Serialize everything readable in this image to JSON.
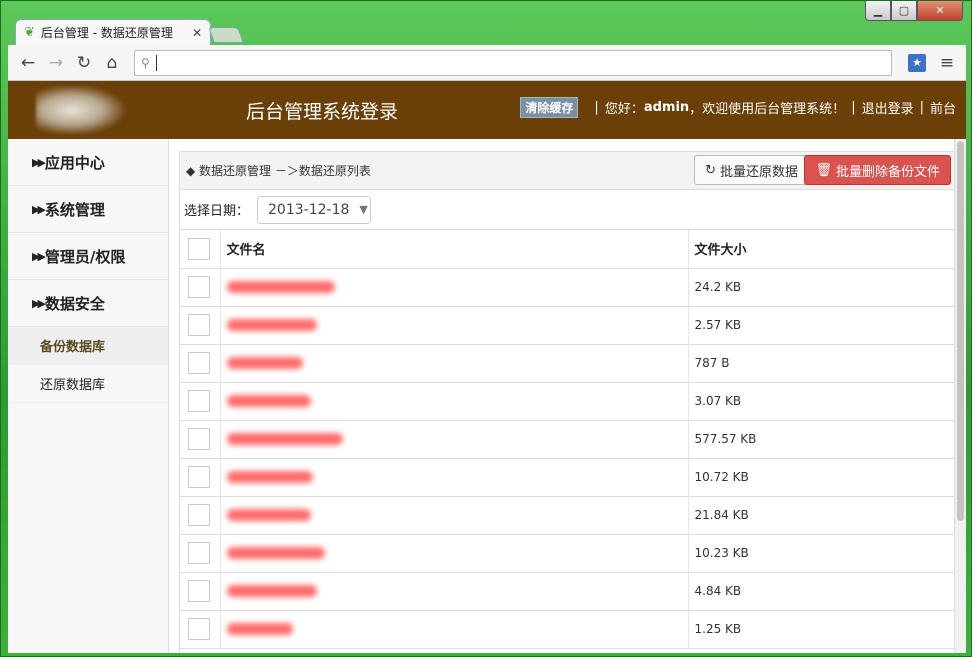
{
  "browser": {
    "tab_title": "后台管理 - 数据还原管理",
    "url": ""
  },
  "header": {
    "site_title": "后台管理系统登录",
    "clear_cache": "清除缓存",
    "greeting": "您好：",
    "user": "admin",
    "welcome": "，欢迎使用后台管理系统！",
    "logout": "退出登录",
    "frontend": "前台"
  },
  "sidebar": {
    "groups": [
      {
        "label": "应用中心"
      },
      {
        "label": "系统管理"
      },
      {
        "label": "管理员/权限"
      },
      {
        "label": "数据安全"
      }
    ],
    "subitems": [
      {
        "label": "备份数据库"
      },
      {
        "label": "还原数据库"
      }
    ]
  },
  "main": {
    "breadcrumb": "◆ 数据还原管理 －＞数据还原列表",
    "restore_button": "批量还原数据",
    "delete_button": "批量删除备份文件",
    "filter_label": "选择日期：",
    "date_value": "2013-12-18",
    "columns": {
      "name": "文件名",
      "size": "文件大小"
    },
    "rows": [
      {
        "size": "24.2 KB",
        "redact_w": 108
      },
      {
        "size": "2.57 KB",
        "redact_w": 90
      },
      {
        "size": "787 B",
        "redact_w": 76
      },
      {
        "size": "3.07 KB",
        "redact_w": 84
      },
      {
        "size": "577.57 KB",
        "redact_w": 116
      },
      {
        "size": "10.72 KB",
        "redact_w": 86
      },
      {
        "size": "21.84 KB",
        "redact_w": 84
      },
      {
        "size": "10.23 KB",
        "redact_w": 98
      },
      {
        "size": "4.84 KB",
        "redact_w": 90
      },
      {
        "size": "1.25 KB",
        "redact_w": 66
      }
    ]
  },
  "colors": {
    "header_bg": "#6b3f08",
    "delete_btn": "#d9534f",
    "redaction": "#ff5050"
  }
}
